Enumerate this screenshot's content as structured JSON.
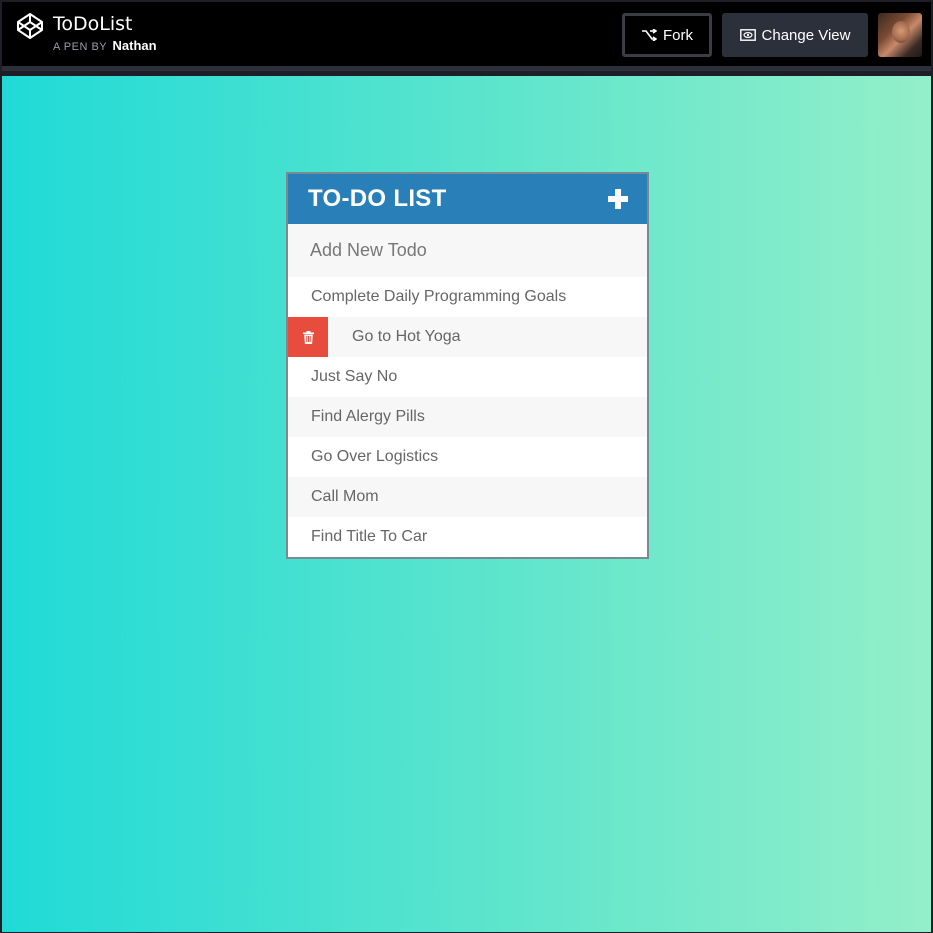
{
  "header": {
    "pen_title": "ToDoList",
    "byline_prefix": "A PEN BY",
    "author": "Nathan",
    "fork_label": "Fork",
    "change_view_label": "Change View"
  },
  "card": {
    "title": "TO-DO LIST",
    "new_todo_placeholder": "Add New Todo",
    "todos": [
      {
        "text": "Complete Daily Programming Goals"
      },
      {
        "text": "Go to Hot Yoga"
      },
      {
        "text": "Just Say No"
      },
      {
        "text": "Find Alergy Pills"
      },
      {
        "text": "Go Over Logistics"
      },
      {
        "text": "Call Mom"
      },
      {
        "text": "Find Title To Car"
      }
    ]
  },
  "colors": {
    "header_bg": "#2980b9",
    "delete_bg": "#e74c3c",
    "gradient_start": "#20dad7",
    "gradient_end": "#93efc9"
  }
}
